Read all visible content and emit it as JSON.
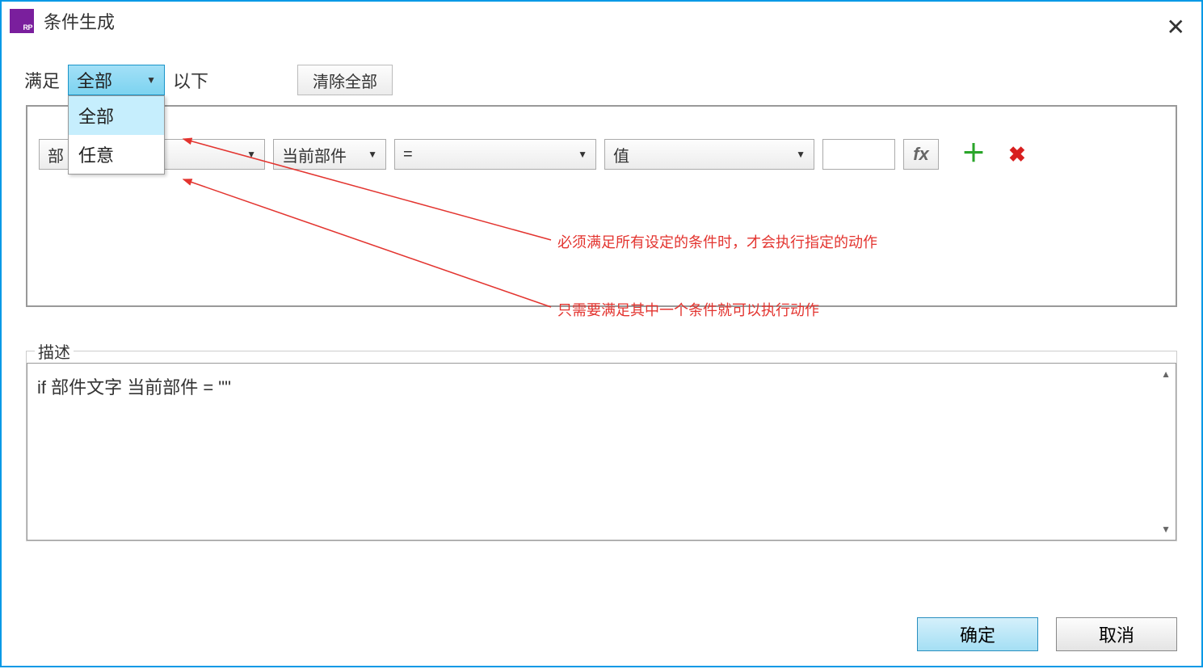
{
  "titlebar": {
    "title": "条件生成",
    "app_badge": "RP"
  },
  "top": {
    "satisfy_label": "满足",
    "match_selected": "全部",
    "following_label": "以下",
    "clear_all": "清除全部",
    "options": {
      "all": "全部",
      "any": "任意"
    }
  },
  "condition_row": {
    "field1": "部",
    "field2": "当前部件",
    "operator": "=",
    "value_type": "值",
    "value_input": "",
    "fx_label": "fx"
  },
  "annotations": {
    "all_note": "必须满足所有设定的条件时，才会执行指定的动作",
    "any_note": "只需要满足其中一个条件就可以执行动作"
  },
  "description": {
    "legend": "描述",
    "text": "if 部件文字 当前部件 = \"\""
  },
  "buttons": {
    "ok": "确定",
    "cancel": "取消"
  }
}
